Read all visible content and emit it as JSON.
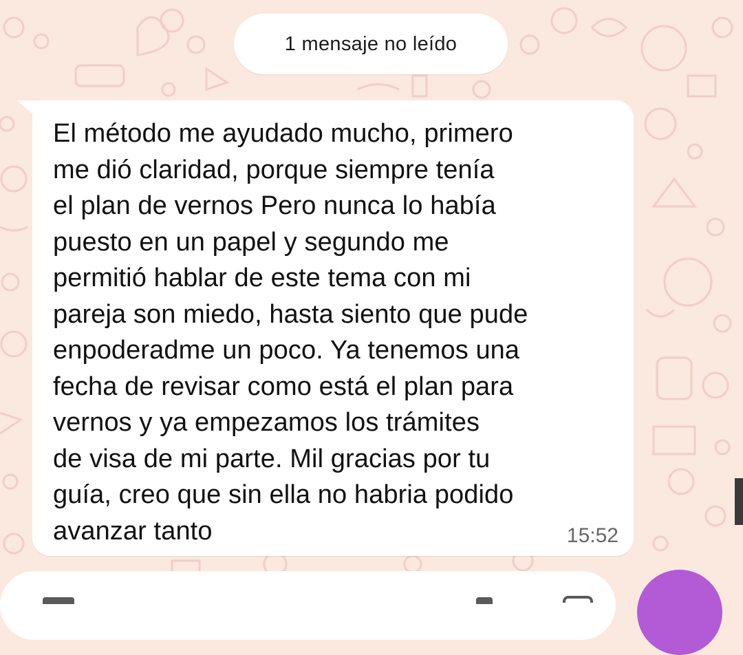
{
  "unread_banner": {
    "label": "1 mensaje no leído"
  },
  "message": {
    "text": "El método me ayudado mucho, primero\nme dió claridad, porque siempre tenía\nel plan de vernos Pero nunca lo había\npuesto en un papel y segundo me\npermitió hablar de este tema con mi\npareja son miedo, hasta siento que pude\nenpoderadme un poco. Ya tenemos una\nfecha de revisar como está el plan para\nvernos y ya empezamos los trámites\nde visa de mi parte. Mil gracias por tu\nguía, creo que sin ella no habria podido\navanzar tanto",
    "time": "15:52"
  },
  "composer": {
    "left_icon": "emoji-icon",
    "attach_icon": "attach-icon",
    "camera_icon": "camera-icon"
  },
  "fab": {
    "icon": "mic-icon"
  },
  "colors": {
    "background": "#fbe8df",
    "wallpaper_doodle": "#f0cfc6",
    "bubble": "#ffffff",
    "fab": "#b35bd6"
  }
}
